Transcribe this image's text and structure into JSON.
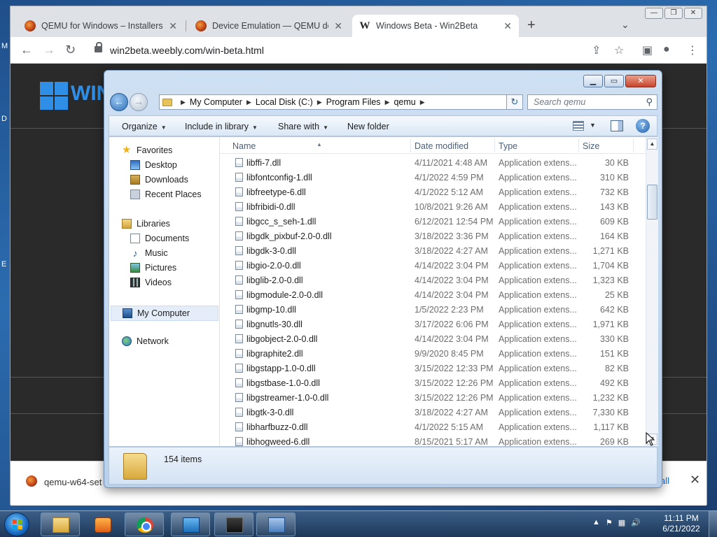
{
  "browser": {
    "tabs": [
      {
        "title": "QEMU for Windows – Installers (",
        "icon": "qemu-favicon"
      },
      {
        "title": "Device Emulation — QEMU docu",
        "icon": "qemu-favicon"
      },
      {
        "title": "Windows Beta - Win2Beta",
        "icon": "win2beta-favicon"
      }
    ],
    "url": "win2beta.weebly.com/win-beta.html",
    "site_logo_text": "WIN",
    "download_bar": {
      "filename": "qemu-w64-set",
      "show_all": "all"
    }
  },
  "explorer": {
    "breadcrumb": [
      "My Computer",
      "Local Disk (C:)",
      "Program Files",
      "qemu"
    ],
    "search_placeholder": "Search qemu",
    "commands": [
      "Organize",
      "Include in library",
      "Share with",
      "New folder"
    ],
    "nav": {
      "favorites": {
        "header": "Favorites",
        "items": [
          "Desktop",
          "Downloads",
          "Recent Places"
        ]
      },
      "libraries": {
        "header": "Libraries",
        "items": [
          "Documents",
          "Music",
          "Pictures",
          "Videos"
        ]
      },
      "computer": "My Computer",
      "network": "Network"
    },
    "columns": [
      "Name",
      "Date modified",
      "Type",
      "Size"
    ],
    "files": [
      {
        "name": "libffi-7.dll",
        "date": "4/11/2021 4:48 AM",
        "type": "Application extens...",
        "size": "30 KB"
      },
      {
        "name": "libfontconfig-1.dll",
        "date": "4/1/2022 4:59 PM",
        "type": "Application extens...",
        "size": "310 KB"
      },
      {
        "name": "libfreetype-6.dll",
        "date": "4/1/2022 5:12 AM",
        "type": "Application extens...",
        "size": "732 KB"
      },
      {
        "name": "libfribidi-0.dll",
        "date": "10/8/2021 9:26 AM",
        "type": "Application extens...",
        "size": "143 KB"
      },
      {
        "name": "libgcc_s_seh-1.dll",
        "date": "6/12/2021 12:54 PM",
        "type": "Application extens...",
        "size": "609 KB"
      },
      {
        "name": "libgdk_pixbuf-2.0-0.dll",
        "date": "3/18/2022 3:36 PM",
        "type": "Application extens...",
        "size": "164 KB"
      },
      {
        "name": "libgdk-3-0.dll",
        "date": "3/18/2022 4:27 AM",
        "type": "Application extens...",
        "size": "1,271 KB"
      },
      {
        "name": "libgio-2.0-0.dll",
        "date": "4/14/2022 3:04 PM",
        "type": "Application extens...",
        "size": "1,704 KB"
      },
      {
        "name": "libglib-2.0-0.dll",
        "date": "4/14/2022 3:04 PM",
        "type": "Application extens...",
        "size": "1,323 KB"
      },
      {
        "name": "libgmodule-2.0-0.dll",
        "date": "4/14/2022 3:04 PM",
        "type": "Application extens...",
        "size": "25 KB"
      },
      {
        "name": "libgmp-10.dll",
        "date": "1/5/2022 2:23 PM",
        "type": "Application extens...",
        "size": "642 KB"
      },
      {
        "name": "libgnutls-30.dll",
        "date": "3/17/2022 6:06 PM",
        "type": "Application extens...",
        "size": "1,971 KB"
      },
      {
        "name": "libgobject-2.0-0.dll",
        "date": "4/14/2022 3:04 PM",
        "type": "Application extens...",
        "size": "330 KB"
      },
      {
        "name": "libgraphite2.dll",
        "date": "9/9/2020 8:45 PM",
        "type": "Application extens...",
        "size": "151 KB"
      },
      {
        "name": "libgstapp-1.0-0.dll",
        "date": "3/15/2022 12:33 PM",
        "type": "Application extens...",
        "size": "82 KB"
      },
      {
        "name": "libgstbase-1.0-0.dll",
        "date": "3/15/2022 12:26 PM",
        "type": "Application extens...",
        "size": "492 KB"
      },
      {
        "name": "libgstreamer-1.0-0.dll",
        "date": "3/15/2022 12:26 PM",
        "type": "Application extens...",
        "size": "1,232 KB"
      },
      {
        "name": "libgtk-3-0.dll",
        "date": "3/18/2022 4:27 AM",
        "type": "Application extens...",
        "size": "7,330 KB"
      },
      {
        "name": "libharfbuzz-0.dll",
        "date": "4/1/2022 5:15 AM",
        "type": "Application extens...",
        "size": "1,117 KB"
      },
      {
        "name": "libhogweed-6.dll",
        "date": "8/15/2021 5:17 AM",
        "type": "Application extens...",
        "size": "269 KB"
      }
    ],
    "item_count": "154 items"
  },
  "taskbar": {
    "apps": [
      "windows-explorer",
      "media-center",
      "google-chrome",
      "remote-desktop",
      "task-manager",
      "control-panel"
    ],
    "time": "11:11 PM",
    "date": "6/21/2022"
  }
}
